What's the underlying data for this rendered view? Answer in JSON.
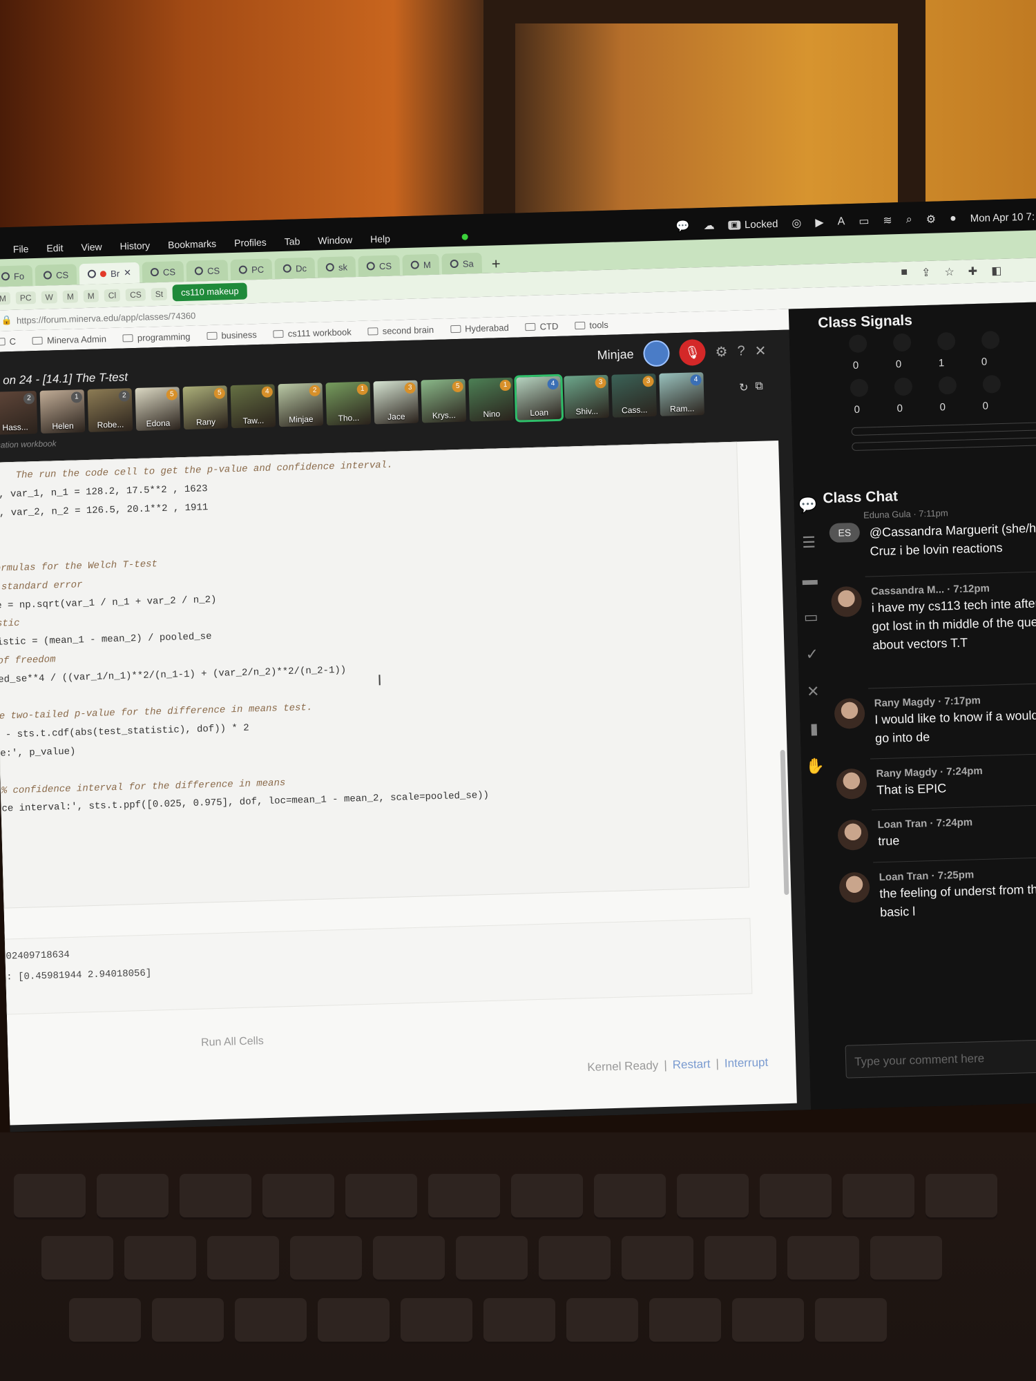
{
  "menubar": {
    "items": [
      "File",
      "Edit",
      "View",
      "History",
      "Bookmarks",
      "Profiles",
      "Tab",
      "Window",
      "Help"
    ],
    "locked_label": "Locked",
    "datetime": "Mon Apr 10 7:"
  },
  "tabs": {
    "items": [
      "Fo",
      "CS",
      "Br",
      "CS",
      "CS",
      "PC",
      "Dc",
      "sk",
      "CS",
      "M",
      "Sa"
    ],
    "highlighted_group": "cs110 makeup"
  },
  "toolbar": {
    "ext_labels": [
      "M",
      "PC",
      "W",
      "M",
      "M",
      "Cl",
      "CS",
      "St"
    ]
  },
  "url": "https://forum.minerva.edu/app/classes/74360",
  "bookmarks": [
    "C",
    "Minerva Admin",
    "programming",
    "business",
    "cs111 workbook",
    "second brain",
    "Hyderabad",
    "CTD",
    "tools"
  ],
  "class": {
    "title": "on 24 - [14.1] The T-test",
    "host_name": "Minjae",
    "workbook_label": "cation workbook"
  },
  "participants": [
    {
      "name": "Hass...",
      "badge": "2"
    },
    {
      "name": "Helen",
      "badge": "1"
    },
    {
      "name": "Robe...",
      "badge": "2"
    },
    {
      "name": "Edona",
      "badge": "5"
    },
    {
      "name": "Rany",
      "badge": "5"
    },
    {
      "name": "Taw...",
      "badge": "4"
    },
    {
      "name": "Minjae",
      "badge": "2"
    },
    {
      "name": "Tho...",
      "badge": "1"
    },
    {
      "name": "Jace",
      "badge": "3"
    },
    {
      "name": "Krys...",
      "badge": "5"
    },
    {
      "name": "Nino",
      "badge": "1"
    },
    {
      "name": "Loan",
      "badge": "4"
    },
    {
      "name": "Shiv...",
      "badge": "3"
    },
    {
      "name": "Cass...",
      "badge": "3"
    },
    {
      "name": "Ram...",
      "badge": "4"
    }
  ],
  "code_lines": [
    {
      "text": "    The run the code cell to get the p-value and confidence interval.",
      "comment": true
    },
    {
      "text": "1, var_1, n_1 = 128.2, 17.5**2 , 1623",
      "comment": false
    },
    {
      "text": "2, var_2, n_2 = 126.5, 20.1**2 , 1911",
      "comment": false
    },
    {
      "text": "",
      "comment": false
    },
    {
      "text": "",
      "comment": false
    },
    {
      "text": "ormulas for the Welch T-test",
      "comment": true
    },
    {
      "text": " standard error",
      "comment": true
    },
    {
      "text": "e = np.sqrt(var_1 / n_1 + var_2 / n_2)",
      "comment": false
    },
    {
      "text": "stic",
      "comment": true
    },
    {
      "text": "istic = (mean_1 - mean_2) / pooled_se",
      "comment": false
    },
    {
      "text": "of freedom",
      "comment": true
    },
    {
      "text": "ed_se**4 / ((var_1/n_1)**2/(n_1-1) + (var_2/n_2)**2/(n_2-1))",
      "comment": false
    },
    {
      "text": "",
      "comment": false
    },
    {
      "text": "e two-tailed p-value for the difference in means test.",
      "comment": true
    },
    {
      "text": " - sts.t.cdf(abs(test_statistic), dof)) * 2",
      "comment": false
    },
    {
      "text": "e:', p_value)",
      "comment": false
    },
    {
      "text": "",
      "comment": false
    },
    {
      "text": "% confidence interval for the difference in means",
      "comment": true
    },
    {
      "text": "ce interval:', sts.t.ppf([0.025, 0.975], dof, loc=mean_1 - mean_2, scale=pooled_se))",
      "comment": false
    }
  ],
  "output_lines": [
    "02409718634",
    ": [0.45981944 2.94018056]"
  ],
  "run_all_label": "Run All Cells",
  "kernel": {
    "status": "Kernel Ready",
    "restart": "Restart",
    "interrupt": "Interrupt"
  },
  "signals": {
    "title": "Class Signals",
    "row1": [
      "0",
      "0",
      "1",
      "0"
    ],
    "row2": [
      "0",
      "0",
      "0",
      "0"
    ]
  },
  "chat": {
    "title": "Class Chat",
    "partial_sender": "Eduna Gula · 7:11pm",
    "messages": [
      {
        "initials": "ES",
        "meta": "",
        "text": "@Cassandra Marguerit (she/her) Cruz i be lovin reactions"
      },
      {
        "initials": "",
        "meta": "Cassandra M... · 7:12pm",
        "text": "i have my cs113 tech inte after class i got lost in th middle of the question t about vectors T.T"
      },
      {
        "initials": "",
        "meta": "Rany Magdy · 7:17pm",
        "text": "I would like to know if a would like to go into de"
      },
      {
        "initials": "",
        "meta": "Rany Magdy · 7:24pm",
        "text": "That is EPIC"
      },
      {
        "initials": "",
        "meta": "Loan Tran · 7:24pm",
        "text": "true"
      },
      {
        "initials": "",
        "meta": "Loan Tran · 7:25pm",
        "text": "the feeling of underst from the most basic l"
      }
    ],
    "input_placeholder": "Type your comment here"
  }
}
